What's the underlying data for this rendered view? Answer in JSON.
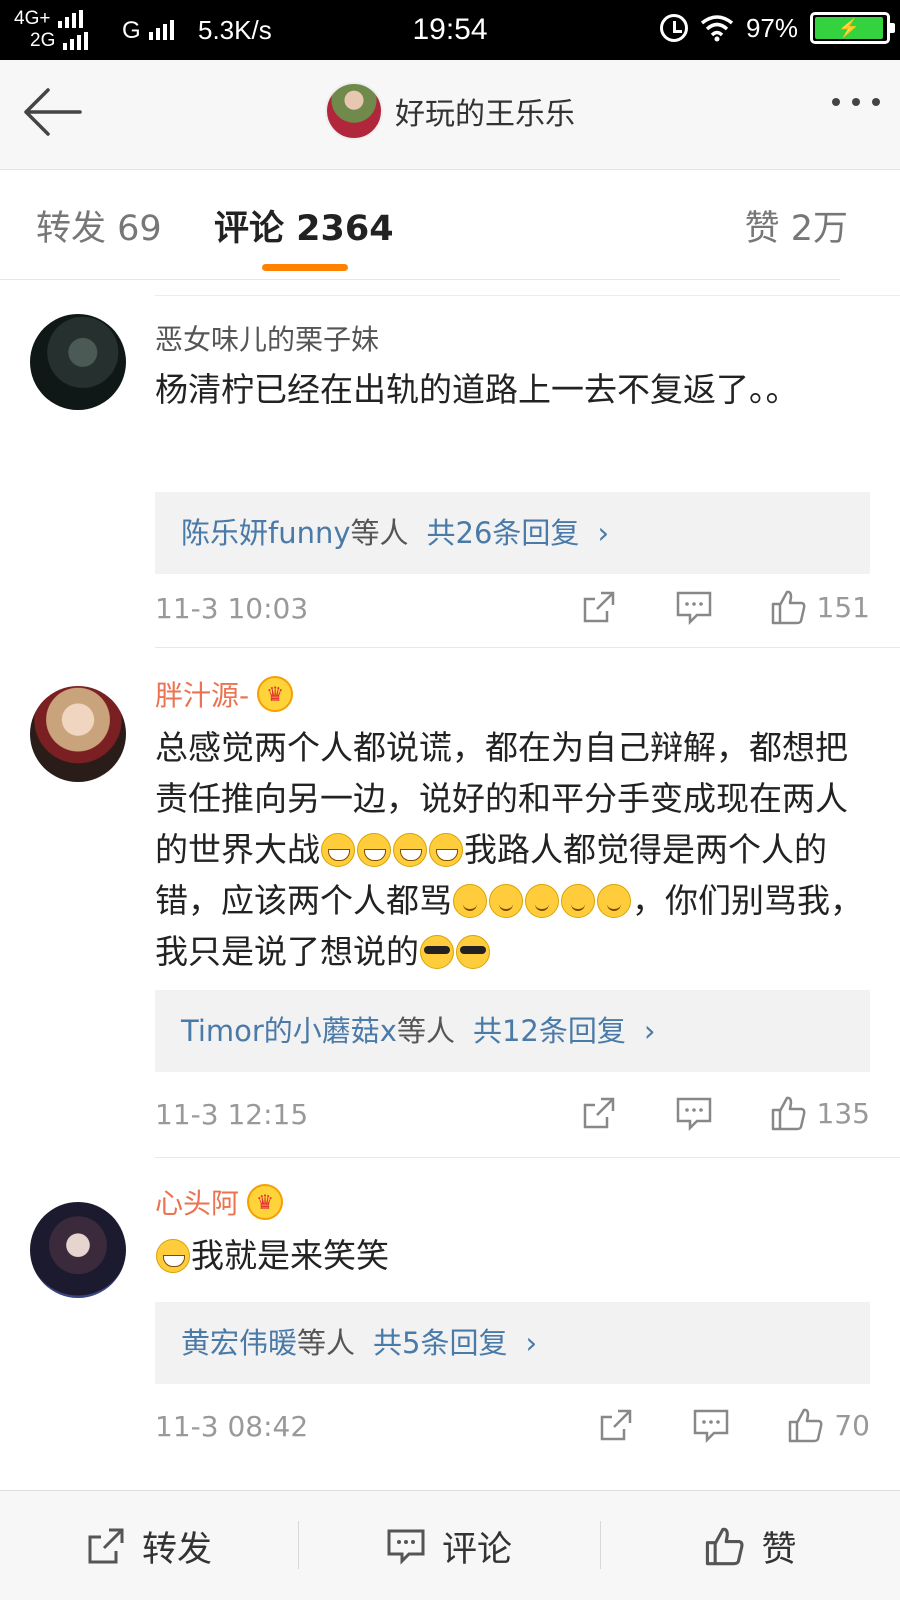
{
  "status_bar": {
    "net_line1": "4G+",
    "net_line2": "2G",
    "carrier": "G",
    "speed": "5.3K/s",
    "time": "19:54",
    "battery_percent": "97%",
    "battery_level": 0.97,
    "battery_color": "#34d23f"
  },
  "header": {
    "title": "好玩的王乐乐",
    "back_icon": "back-arrow-icon",
    "more_icon": "more-dots-icon"
  },
  "tabs": {
    "repost": "转发 69",
    "comments": "评论 2364",
    "likes": "赞 2万",
    "active": "comments",
    "accent_color": "#ff8200"
  },
  "comments": [
    {
      "username": "恶女味儿的栗子妹",
      "username_color": "#555555",
      "vip": false,
      "text": "杨清柠已经在出轨的道路上一去不复返了。。",
      "reply_names": "陈乐妍funny",
      "reply_suffix": "等人",
      "reply_total": "共26条回复",
      "date": "11-3 10:03",
      "likes": "151"
    },
    {
      "username": "胖汁源-",
      "username_color": "#eb7350",
      "vip": true,
      "text_parts": [
        "总感觉两个人都说谎，都在为自己辩解，都想把责任推向另一边，说好的和平分手变成现在两人的世界大战",
        "我路人都觉得是两个人的错，应该两个人都骂",
        "，你们别骂我，我只是说了想说的"
      ],
      "reply_names": "Timor的小蘑菇x",
      "reply_suffix": "等人",
      "reply_total": "共12条回复",
      "date": "11-3 12:15",
      "likes": "135"
    },
    {
      "username": "心头阿",
      "username_color": "#eb7350",
      "vip": true,
      "text": "我就是来笑笑",
      "reply_names": "黄宏伟暖",
      "reply_suffix": "等人",
      "reply_total": "共5条回复",
      "date": "11-3 08:42",
      "likes": "70"
    }
  ],
  "bottom_bar": {
    "repost": "转发",
    "comment": "评论",
    "like": "赞"
  },
  "reply_chevron": "›"
}
